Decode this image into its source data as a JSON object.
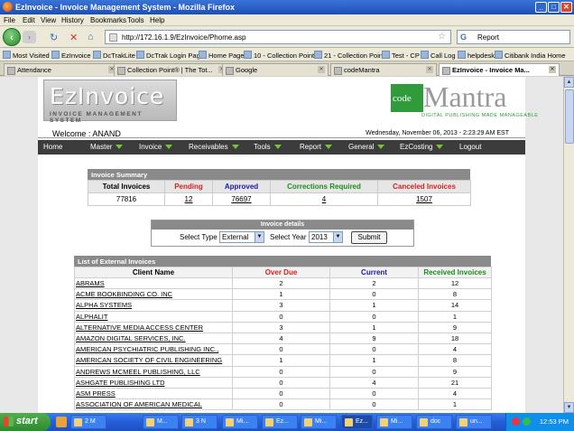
{
  "window": {
    "title": "EzInvoice - Invoice Management System - Mozilla Firefox"
  },
  "menu": [
    "File",
    "Edit",
    "View",
    "History",
    "Bookmarks",
    "Tools",
    "Help"
  ],
  "nav": {
    "url": "http://172.16.1.9/EzInvoice/Phome.asp",
    "search_value": "Report"
  },
  "bookmarks": [
    "Most Visited",
    "EzInvoice",
    "DcTrakLite",
    "DcTrak Login Page",
    "Home Page",
    "10 - Collection Point",
    "21 - Collection Point",
    "Test - CP",
    "Call Log",
    "helpdesk",
    "Citibank India Home"
  ],
  "tabs": [
    {
      "label": "Attendance",
      "active": false
    },
    {
      "label": "Collection Point® | The Tot...",
      "active": false
    },
    {
      "label": "Google",
      "active": false
    },
    {
      "label": "codeMantra",
      "active": false
    },
    {
      "label": "EzInvoice - Invoice Ma...",
      "active": true
    }
  ],
  "header": {
    "logo_main": "EzInvoice",
    "logo_sub": "INVOICE MANAGEMENT SYSTEM",
    "brand_code": "code",
    "brand_mantra": "Mantra",
    "brand_tagline": "DIGITAL PUBLISHING MADE MANAGEABLE",
    "welcome": "Welcome : ANAND",
    "datetime": "Wednesday, November 06, 2013 - 2:23:29 AM EST"
  },
  "main_nav": [
    {
      "label": "Home",
      "dropdown": false
    },
    {
      "label": "Master",
      "dropdown": true
    },
    {
      "label": "Invoice",
      "dropdown": true
    },
    {
      "label": "Receivables",
      "dropdown": true
    },
    {
      "label": "Tools",
      "dropdown": true
    },
    {
      "label": "Report",
      "dropdown": true
    },
    {
      "label": "General",
      "dropdown": true
    },
    {
      "label": "EzCosting",
      "dropdown": true
    },
    {
      "label": "Logout",
      "dropdown": false
    }
  ],
  "summary": {
    "title": "Invoice Summary",
    "headers": [
      {
        "label": "Total Invoices",
        "color": "#000000"
      },
      {
        "label": "Pending",
        "color": "#d62020"
      },
      {
        "label": "Approved",
        "color": "#1a1aa8"
      },
      {
        "label": "Corrections Required",
        "color": "#1e8a1e"
      },
      {
        "label": "Canceled Invoices",
        "color": "#d62020"
      }
    ],
    "values": [
      "77816",
      "12",
      "76697",
      "4",
      "1507"
    ]
  },
  "details": {
    "title": "Invoice details",
    "type_label": "Select Type",
    "type_value": "External",
    "year_label": "Select Year",
    "year_value": "2013",
    "submit_label": "Submit"
  },
  "external": {
    "title": "List of External Invoices",
    "headers": [
      {
        "label": "Client Name",
        "color": "#000000"
      },
      {
        "label": "Over Due",
        "color": "#d62020"
      },
      {
        "label": "Current",
        "color": "#1a1aa8"
      },
      {
        "label": "Received Invoices",
        "color": "#1e8a1e"
      }
    ],
    "rows": [
      [
        "ABRAMS",
        "2",
        "2",
        "12"
      ],
      [
        "ACME BOOKBINDING CO. INC",
        "1",
        "0",
        "8"
      ],
      [
        "ALPHA SYSTEMS",
        "3",
        "1",
        "14"
      ],
      [
        "ALPHALIT",
        "0",
        "0",
        "1"
      ],
      [
        "ALTERNATIVE MEDIA ACCESS CENTER",
        "3",
        "1",
        "9"
      ],
      [
        "AMAZON DIGITAL SERVICES, INC.",
        "4",
        "9",
        "18"
      ],
      [
        "AMERICAN PSYCHIATRIC PUBLISHING INC.,",
        "0",
        "0",
        "4"
      ],
      [
        "AMERICAN SOCIETY OF CIVIL ENGINEERING",
        "1",
        "1",
        "8"
      ],
      [
        "ANDREWS MCMEEL PUBLISHING, LLC",
        "0",
        "0",
        "9"
      ],
      [
        "ASHGATE PUBLISHING LTD",
        "0",
        "4",
        "21"
      ],
      [
        "ASM PRESS",
        "0",
        "0",
        "4"
      ],
      [
        "ASSOCIATION OF AMERICAN MEDICAL",
        "0",
        "0",
        "1"
      ]
    ]
  },
  "taskbar": {
    "start_label": "start",
    "items": [
      {
        "label": "2 M",
        "active": false
      },
      {
        "label": "M...",
        "active": false
      },
      {
        "label": "3 N",
        "active": false
      },
      {
        "label": "Mi...",
        "active": false
      },
      {
        "label": "Ez...",
        "active": false
      },
      {
        "label": "Mi...",
        "active": false
      },
      {
        "label": "Ez...",
        "active": true
      },
      {
        "label": "Mi...",
        "active": false
      },
      {
        "label": "doc",
        "active": false
      },
      {
        "label": "un...",
        "active": false
      }
    ],
    "clock": "12:53 PM"
  }
}
